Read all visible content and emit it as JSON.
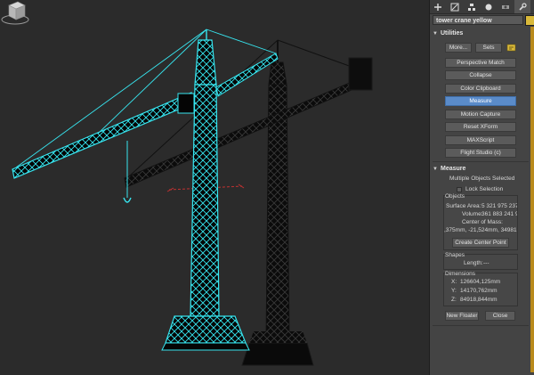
{
  "app": {
    "object_name": "tower crane yellow",
    "accent_color": "#5a8bc9",
    "object_color": "#d9b93a",
    "selection_color": "#37e5ef"
  },
  "tabs": [
    {
      "icon": "create-icon"
    },
    {
      "icon": "modify-icon"
    },
    {
      "icon": "hierarchy-icon"
    },
    {
      "icon": "motion-icon"
    },
    {
      "icon": "display-icon"
    },
    {
      "icon": "utilities-icon"
    }
  ],
  "utilities": {
    "title": "Utilities",
    "more_label": "More...",
    "sets_label": "Sets",
    "buttons": [
      "Perspective Match",
      "Collapse",
      "Color Clipboard",
      "Measure",
      "Motion Capture",
      "Reset XForm",
      "MAXScript",
      "Flight Studio (c)"
    ],
    "active_button": "Measure"
  },
  "measure": {
    "title": "Measure",
    "selection_status": "Multiple Objects Selected",
    "lock_selection_label": "Lock Selection",
    "objects_group_label": "Objects",
    "surface_area_label": "Surface Area:",
    "surface_area_value": "5 321 975 237",
    "volume_label": "Volume:",
    "volume_value": "361 883 241 9",
    "center_of_mass_label": "Center of Mass:",
    "center_of_mass_value": ",375mm, -21,524mm, 34981",
    "create_center_point_label": "Create Center Point",
    "shapes_group_label": "Shapes",
    "length_label": "Length:",
    "length_value": "---",
    "dimensions_group_label": "Dimensions",
    "x_label": "X:",
    "x_value": "126604,125mm",
    "y_label": "Y:",
    "y_value": "14170,762mm",
    "z_label": "Z:",
    "z_value": "84918,844mm",
    "new_floater_label": "New Floater",
    "close_label": "Close"
  }
}
